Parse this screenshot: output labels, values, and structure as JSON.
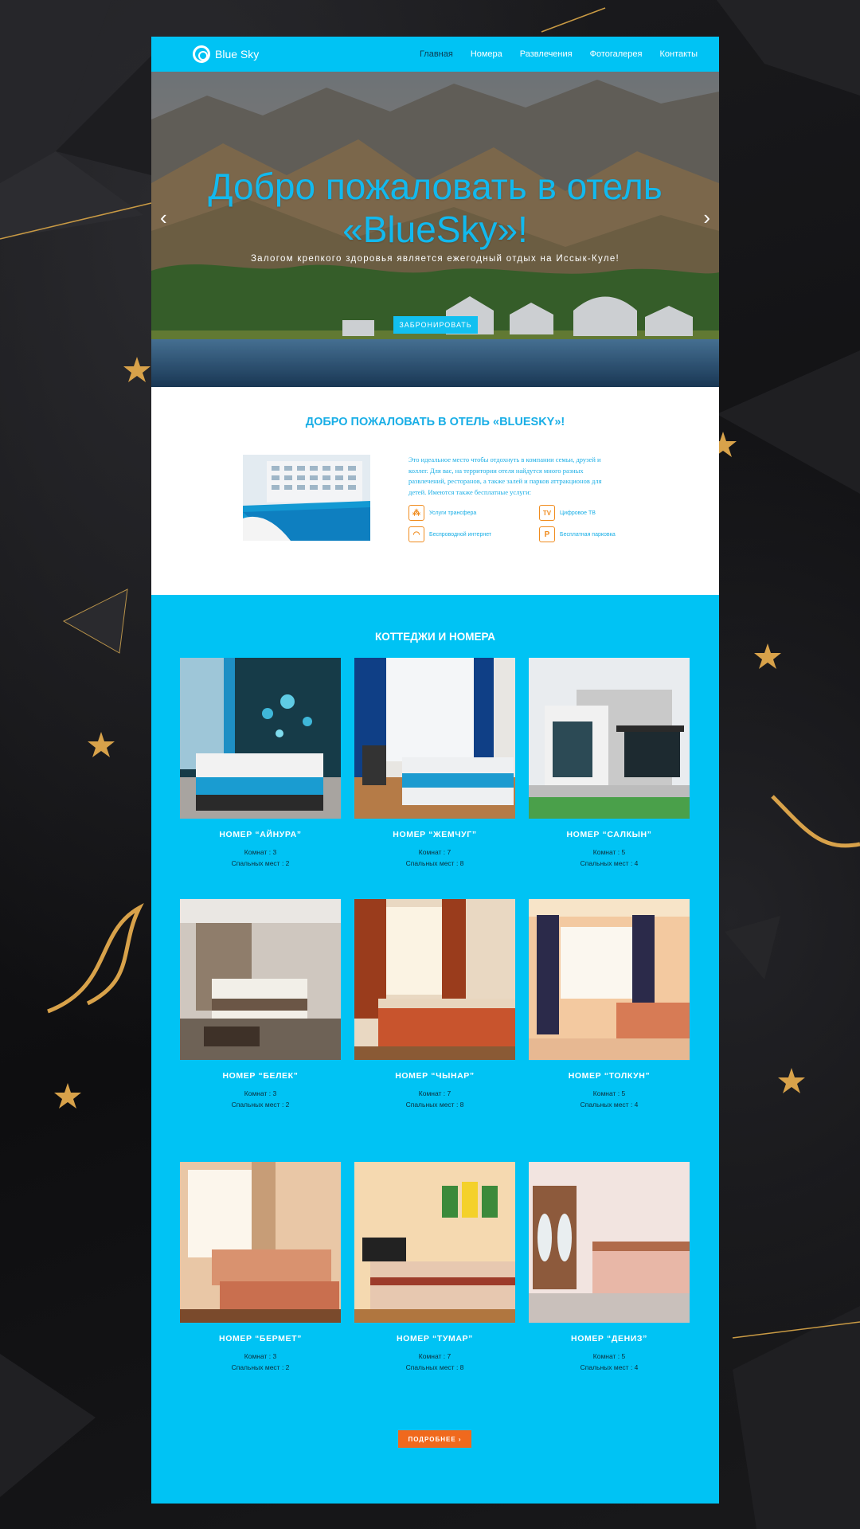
{
  "brand": {
    "name": "Blue Sky"
  },
  "nav": {
    "items": [
      {
        "label": "Главная",
        "active": true
      },
      {
        "label": "Номера"
      },
      {
        "label": "Развлечения"
      },
      {
        "label": "Фотогалерея"
      },
      {
        "label": "Контакты"
      }
    ]
  },
  "hero": {
    "title_line1": "Добро пожаловать в отель",
    "title_line2": "«BlueSky»!",
    "subtitle": "Залогом крепкого здоровья является ежегодный отдых на Иссык-Куле!",
    "button": "ЗАБРОНИРОВАТЬ",
    "prev_icon": "chevron-left-icon",
    "next_icon": "chevron-right-icon"
  },
  "welcome": {
    "heading": "ДОБРО ПОЖАЛОВАТЬ В ОТЕЛЬ «BLUESKY»!",
    "text": "Это идеальное место чтобы отдохнуть в компании семьи, друзей и коллег. Для вас, на территории отеля найдутся много разных развлечений, ресторанов, а также залей и парков аттракционов для детей. Имеются также бесплатные услуги:",
    "amenities": [
      {
        "label": "Услуги трансфера",
        "icon": "shuttle-icon",
        "glyph": "⁂"
      },
      {
        "label": "Цифровое ТВ",
        "icon": "tv-icon",
        "glyph": "TV"
      },
      {
        "label": "Беспроводной интернет",
        "icon": "wifi-icon",
        "glyph": "◠"
      },
      {
        "label": "Бесплатная парковка",
        "icon": "parking-icon",
        "glyph": "P"
      }
    ]
  },
  "cottages": {
    "heading": "КОТТЕДЖИ И НОМЕРА",
    "rooms": [
      {
        "name": "НОМЕР “АЙНУРА”",
        "rooms": "Комнат : 3",
        "beds": "Спальных мест : 2"
      },
      {
        "name": "НОМЕР “ЖЕМЧУГ”",
        "rooms": "Комнат : 7",
        "beds": "Спальных мест : 8"
      },
      {
        "name": "НОМЕР “САЛКЫН”",
        "rooms": "Комнат : 5",
        "beds": "Спальных мест : 4"
      },
      {
        "name": "НОМЕР “БЕЛЕК”",
        "rooms": "Комнат : 3",
        "beds": "Спальных мест : 2"
      },
      {
        "name": "НОМЕР “ЧЫНАР”",
        "rooms": "Комнат : 7",
        "beds": "Спальных мест : 8"
      },
      {
        "name": "НОМЕР “ТОЛКУН”",
        "rooms": "Комнат : 5",
        "beds": "Спальных мест : 4"
      },
      {
        "name": "НОМЕР “БЕРМЕТ”",
        "rooms": "Комнат : 3",
        "beds": "Спальных мест : 2"
      },
      {
        "name": "НОМЕР “ТУМАР”",
        "rooms": "Комнат : 7",
        "beds": "Спальных мест : 8"
      },
      {
        "name": "НОМЕР “ДЕНИЗ”",
        "rooms": "Комнат : 5",
        "beds": "Спальных мест : 4"
      }
    ],
    "more_button": "ПОДРОБНЕЕ  ›"
  },
  "colors": {
    "accent": "#00c3f4",
    "title_blue": "#12b9ee",
    "orange": "#f0691d",
    "background": "#131315",
    "gold": "#d8a24a"
  }
}
